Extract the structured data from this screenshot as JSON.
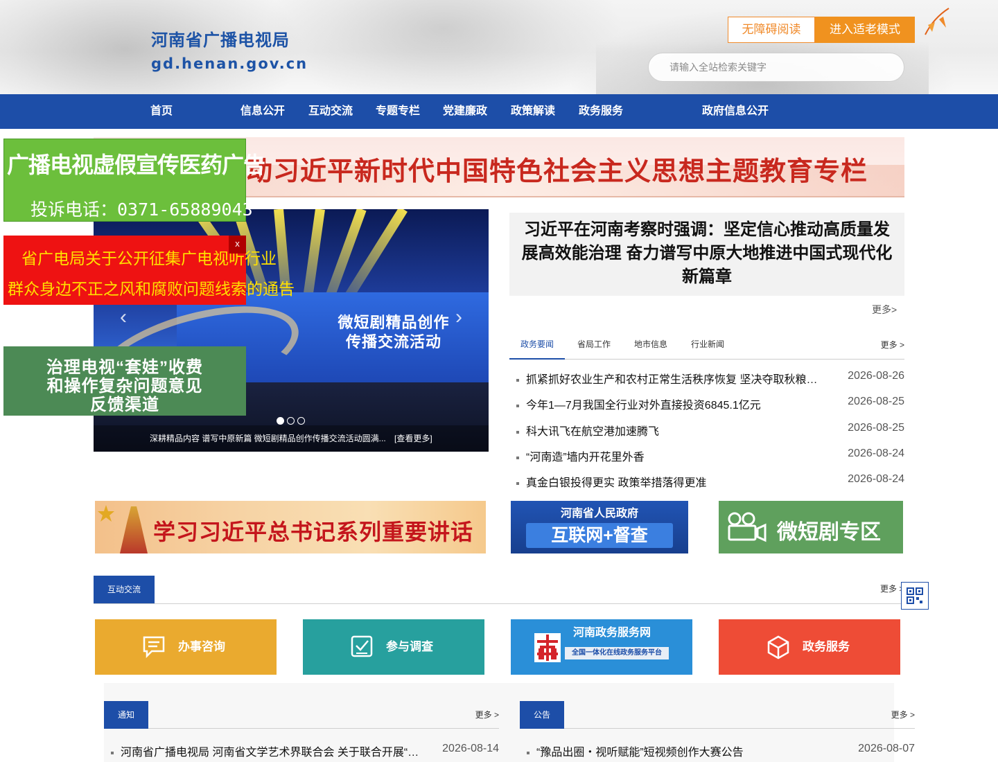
{
  "header": {
    "site_name": "河南省广播电视局",
    "domain": "gd.henan.gov.cn",
    "accessible_label": "无障碍阅读",
    "elderly_label": "进入适老模式",
    "search_placeholder": "请输入全站检索关键字"
  },
  "nav": [
    "首页",
    "信息公开",
    "互动交流",
    "专题专栏",
    "党建廉政",
    "政策解读",
    "政务服务",
    "政府信息公开"
  ],
  "banner_top": {
    "text": "动习近平新时代中国特色社会主义思想主题教育专栏"
  },
  "float_ads": {
    "ad1_title": "广播电视虚假宣传医药广告",
    "ad1_phone": "投诉电话：0371-65889043",
    "ad2_line1": "省广电局关于公开征集广电视听行业",
    "ad2_line2": "群众身边不正之风和腐败问题线索的通告",
    "ad2_close": "x",
    "ad3_lines": [
      "治理电视“套娃”收费",
      "和操作复杂问题意见",
      "反馈渠道"
    ]
  },
  "slider": {
    "stage_title_1": "微短剧精品创作",
    "stage_title_2": "传播交流活动",
    "caption": "深耕精品内容 谱写中原新篇 微短剧精品创作传播交流活动圆满...",
    "more": "[查看更多]",
    "prev_icon": "‹",
    "next_icon": "›",
    "slide_count": 3,
    "active_slide": 1
  },
  "headline": {
    "text": "习近平在河南考察时强调：坚定信心推动高质量发展高效能治理 奋力谱写中原大地推进中国式现代化新篇章",
    "more": "更多>"
  },
  "news_tabs": {
    "tabs": [
      "政务要闻",
      "省局工作",
      "地市信息",
      "行业新闻"
    ],
    "active": 0,
    "more": "更多 >",
    "items": [
      {
        "title": "抓紧抓好农业生产和农村正常生活秩序恢复 坚决夺取秋粮丰收",
        "date": "2026-08-26"
      },
      {
        "title": "今年1—7月我国全行业对外直接投资6845.1亿元",
        "date": "2026-08-25"
      },
      {
        "title": "科大讯飞在航空港加速腾飞",
        "date": "2026-08-25"
      },
      {
        "title": "“河南造”墙内开花里外香",
        "date": "2026-08-24"
      },
      {
        "title": "真金白银投得更实 政策举措落得更准",
        "date": "2026-08-24"
      }
    ]
  },
  "banners": {
    "speech": "学习习近平总书记系列重要讲话",
    "gov_line1": "河南省人民政府",
    "gov_line2": "互联网+督查",
    "drama": "微短剧专区"
  },
  "interaction": {
    "label": "互动交流",
    "more": "更多 >",
    "tiles": [
      {
        "label": "办事咨询",
        "color": "#eaaa2f",
        "icon": "chat-icon"
      },
      {
        "label": "参与调查",
        "color": "#27a09e",
        "icon": "survey-icon"
      },
      {
        "label": "河南政务服务网",
        "sublabel": "全国一体化在线政务服务平台",
        "color": "#2a8fd8",
        "icon": "henan-gov-service-logo"
      },
      {
        "label": "政务服务",
        "color": "#ee4c36",
        "icon": "cube-icon"
      }
    ]
  },
  "notice": {
    "label": "通知",
    "more": "更多 >",
    "items": [
      {
        "title": "河南省广播电视局 河南省文学艺术界联合会 关于联合开展“豫品出圈·视听赋能”短视频创作大赛的通知",
        "date": "2026-08-14"
      }
    ]
  },
  "announcement": {
    "label": "公告",
    "more": "更多 >",
    "items": [
      {
        "title": "“豫品出圈・视听赋能”短视频创作大赛公告",
        "date": "2026-08-07"
      }
    ]
  },
  "colors": {
    "primary": "#1d4ea8",
    "accent_orange": "#f0921f",
    "ad_green": "#6cbf3c",
    "ad_red": "#ee1212"
  }
}
